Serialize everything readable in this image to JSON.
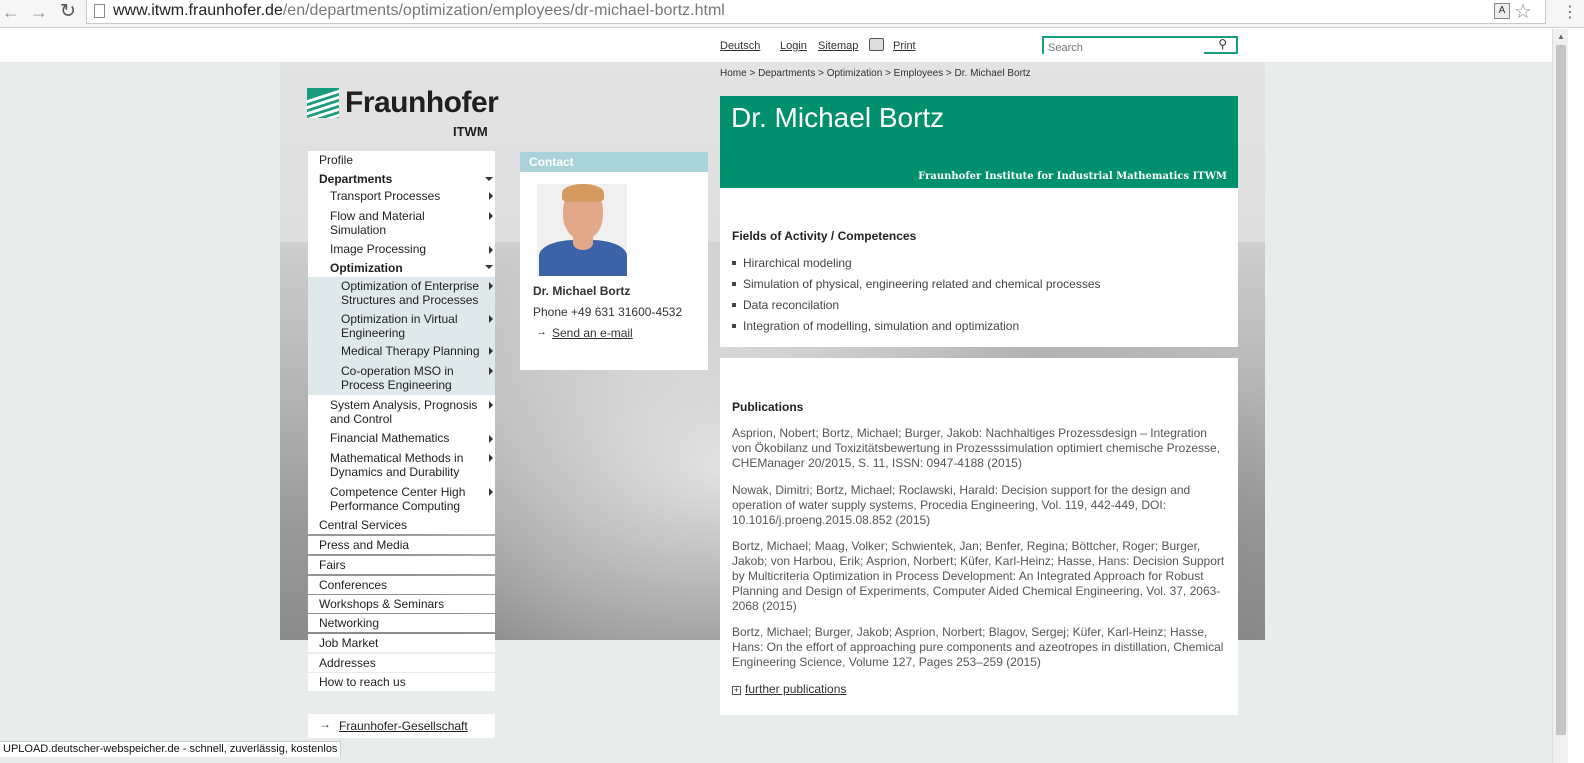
{
  "browser": {
    "url_domain": "www.itwm.fraunhofer.de",
    "url_path": "/en/departments/optimization/employees/dr-michael-bortz.html"
  },
  "utility_nav": {
    "deutsch": "Deutsch",
    "login": "Login",
    "sitemap": "Sitemap",
    "print": "Print",
    "search_placeholder": "Search"
  },
  "logo": {
    "name": "Fraunhofer",
    "institute": "ITWM"
  },
  "breadcrumb": "Home >  Departments > Optimization > Employees > Dr. Michael Bortz",
  "left_nav": {
    "top_items_1": [
      "Profile",
      "Departments"
    ],
    "departments": [
      "Transport Processes",
      "Flow and Material Simulation",
      "Image Processing",
      "Optimization"
    ],
    "optimization_sub": [
      "Optimization of Enterprise Structures and Processes",
      "Optimization in Virtual Engineering",
      "Medical Therapy Planning",
      "Co-operation MSO in Process Engineering"
    ],
    "departments_2": [
      "System Analysis, Prognosis and Control",
      "Financial Mathematics",
      "Mathematical Methods in Dynamics and Durability",
      "Competence Center High Performance Computing"
    ],
    "top_items_2": [
      "Central Services",
      "Press and Media",
      "Fairs",
      "Conferences",
      "Workshops & Seminars",
      "Networking",
      "Job Market",
      "Addresses",
      "How to reach us"
    ],
    "footer_link": "Fraunhofer-Gesellschaft"
  },
  "contact": {
    "heading": "Contact",
    "name": "Dr. Michael Bortz",
    "phone": "Phone +49 631 31600-4532",
    "email_link": "Send an e-mail"
  },
  "profile": {
    "title": "Dr. Michael Bortz",
    "institute": "Fraunhofer Institute for Industrial Mathematics ITWM",
    "fields_heading": "Fields of Activity / Competences",
    "fields": [
      "Hirarchical modeling",
      "Simulation of physical, engineering related and chemical processes",
      "Data reconcilation",
      "Integration of modelling, simulation and optimization"
    ],
    "publications_heading": "Publications",
    "publications": [
      "Asprion, Nobert; Bortz, Michael; Burger, Jakob: Nachhaltiges Prozessdesign – Integration von Ökobilanz und Toxizitätsbewertung in Prozesssimulation optimiert chemische Prozesse, CHEManager 20/2015, S. 11, ISSN: 0947-4188 (2015)",
      "Nowak, Dimitri; Bortz, Michael; Roclawski, Harald: Decision support for the design and operation of water supply systems, Procedia Engineering, Vol. 119, 442-449, DOI: 10.1016/j.proeng.2015.08.852 (2015)",
      "Bortz, Michael; Maag, Volker; Schwientek, Jan; Benfer, Regina; Böttcher, Roger; Burger, Jakob; von Harbou, Erik; Asprion, Norbert; Küfer, Karl-Heinz; Hasse, Hans: Decision Support by Multicriteria Optimization in Process Development: An Integrated Approach for Robust Planning and Design of Experiments, Computer Aided Chemical Engineering, Vol. 37, 2063-2068 (2015)",
      "Bortz, Michael; Burger, Jakob; Asprion, Norbert; Blagov, Sergej; Küfer, Karl-Heinz; Hasse, Hans: On the effort of approaching pure components and azeotropes in distillation, Chemical Engineering Science, Volume 127, Pages 253–259 (2015)"
    ],
    "further_link": "further publications"
  },
  "status_bar": "UPLOAD.deutscher-webspeicher.de - schnell, zuverlässig, kostenlos",
  "colors": {
    "brand_green": "#00906d",
    "contact_head": "#a9d3d9",
    "submenu_highlight": "#dde9ea"
  },
  "icons": [
    "back-icon",
    "forward-icon",
    "reload-icon",
    "page-icon",
    "translate-icon",
    "star-icon",
    "print-icon",
    "search-icon",
    "arrow-right-icon",
    "plus-icon"
  ]
}
